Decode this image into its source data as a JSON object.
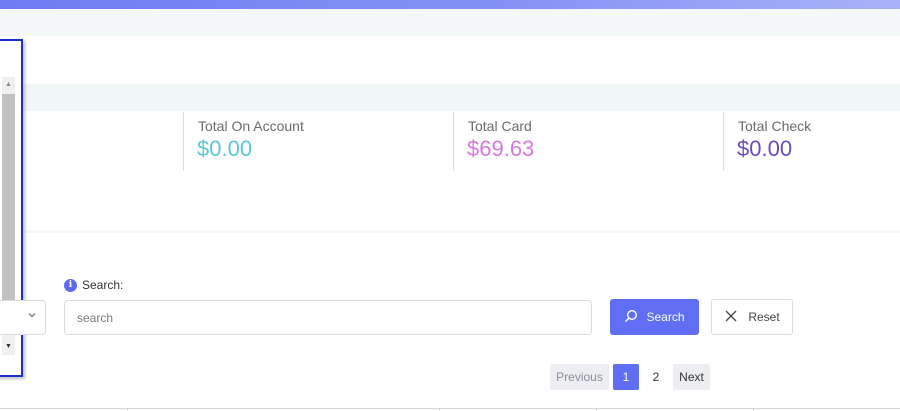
{
  "stats": [
    {
      "label": "Total On Account",
      "value": "$0.00",
      "color": "#5bc8d6"
    },
    {
      "label": "Total Card",
      "value": "$69.63",
      "color": "#d778de"
    },
    {
      "label": "Total Check",
      "value": "$0.00",
      "color": "#6b4bbf"
    }
  ],
  "search": {
    "label": "Search:",
    "placeholder": "search",
    "search_button": "Search",
    "reset_button": "Reset"
  },
  "pagination": {
    "previous": "Previous",
    "pages": [
      "1",
      "2"
    ],
    "active_page": "1",
    "next": "Next"
  },
  "colors": {
    "accent": "#5f6ef3",
    "overlay_border": "#1f2fc9"
  },
  "icons": [
    "info-icon",
    "search-icon",
    "close-icon",
    "chevron-down-icon",
    "scroll-up-arrow-icon",
    "scroll-down-arrow-icon"
  ]
}
